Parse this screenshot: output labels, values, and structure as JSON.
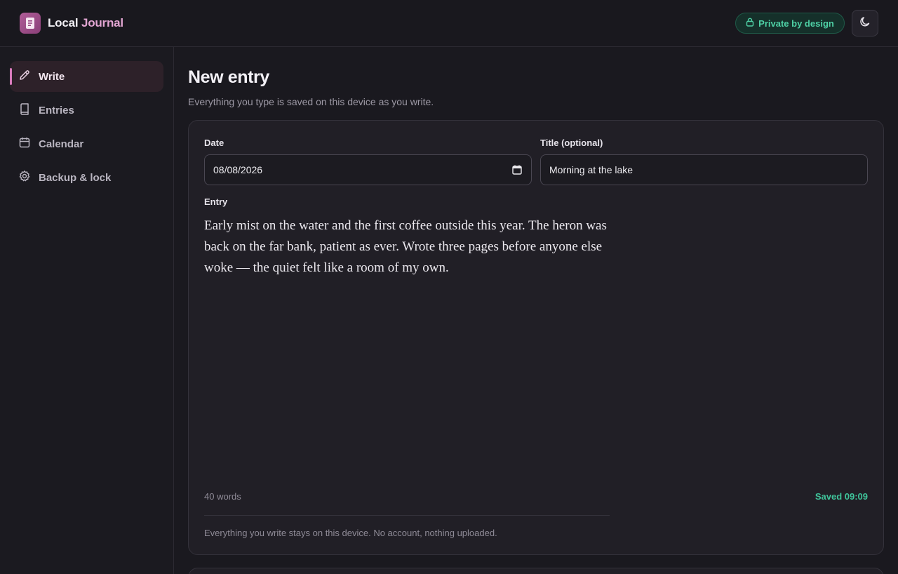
{
  "app": {
    "title_part1": "Local",
    "title_part2": "Journal",
    "logo_icon": "journal-icon",
    "privacy_badge": "Private by design",
    "theme_toggle_icon": "moon-icon"
  },
  "sidebar": {
    "items": [
      {
        "label": "Write",
        "icon": "pencil-icon",
        "active": true
      },
      {
        "label": "Entries",
        "icon": "book-icon",
        "active": false
      },
      {
        "label": "Calendar",
        "icon": "calendar-icon",
        "active": false
      },
      {
        "label": "Backup & lock",
        "icon": "gear-icon",
        "active": false
      }
    ]
  },
  "main": {
    "title": "New entry",
    "subtitle": "Everything you type is saved on this device as you write."
  },
  "form": {
    "date_label": "Date",
    "date_value": "08/08/2026",
    "title_label": "Title (optional)",
    "title_value": "Morning at the lake",
    "entry_label": "Entry",
    "entry_text": "Early mist on the water and the first coffee outside this year. The heron was back on the far bank, patient as ever. Wrote three pages before anyone else woke — the quiet felt like a room of my own.",
    "word_count": "40 words",
    "saved_status": "Saved 09:09",
    "footer_note": "Everything you write stays on this device. No account, nothing uploaded."
  },
  "colors": {
    "accent": "#d97bbd",
    "success": "#3fc39a",
    "background": "#1a191f",
    "card": "#211f26"
  }
}
